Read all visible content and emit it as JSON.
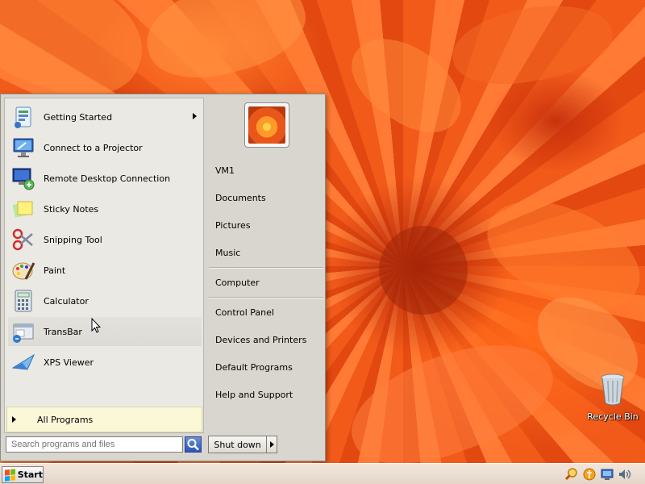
{
  "start_menu": {
    "programs": [
      {
        "label": "Getting Started",
        "icon": "getting-started-icon",
        "has_submenu": true
      },
      {
        "label": "Connect to a Projector",
        "icon": "projector-icon",
        "has_submenu": false
      },
      {
        "label": "Remote Desktop Connection",
        "icon": "remote-desktop-icon",
        "has_submenu": false
      },
      {
        "label": "Sticky Notes",
        "icon": "sticky-notes-icon",
        "has_submenu": false
      },
      {
        "label": "Snipping Tool",
        "icon": "snipping-tool-icon",
        "has_submenu": false
      },
      {
        "label": "Paint",
        "icon": "paint-icon",
        "has_submenu": false
      },
      {
        "label": "Calculator",
        "icon": "calculator-icon",
        "has_submenu": false
      },
      {
        "label": "TransBar",
        "icon": "transbar-icon",
        "has_submenu": false
      },
      {
        "label": "XPS Viewer",
        "icon": "xps-viewer-icon",
        "has_submenu": false
      }
    ],
    "all_programs_label": "All Programs",
    "search_placeholder": "Search programs and files",
    "places": [
      "VM1",
      "Documents",
      "Pictures",
      "Music",
      "Computer",
      "Control Panel",
      "Devices and Printers",
      "Default Programs",
      "Help and Support"
    ],
    "shutdown_label": "Shut down"
  },
  "desktop": {
    "recycle_bin_label": "Recycle Bin"
  },
  "taskbar": {
    "start_label": "Start",
    "tray_icons": [
      "search-tray-icon",
      "security-tray-icon",
      "network-tray-icon",
      "volume-tray-icon"
    ]
  },
  "colors": {
    "wallpaper": "#f05a18",
    "menu_bg": "#d9d6cf",
    "left_pane_bg": "#ebe9e4",
    "all_programs_bg": "#fbf8d8",
    "taskbar_bg": "#ece0d4"
  }
}
